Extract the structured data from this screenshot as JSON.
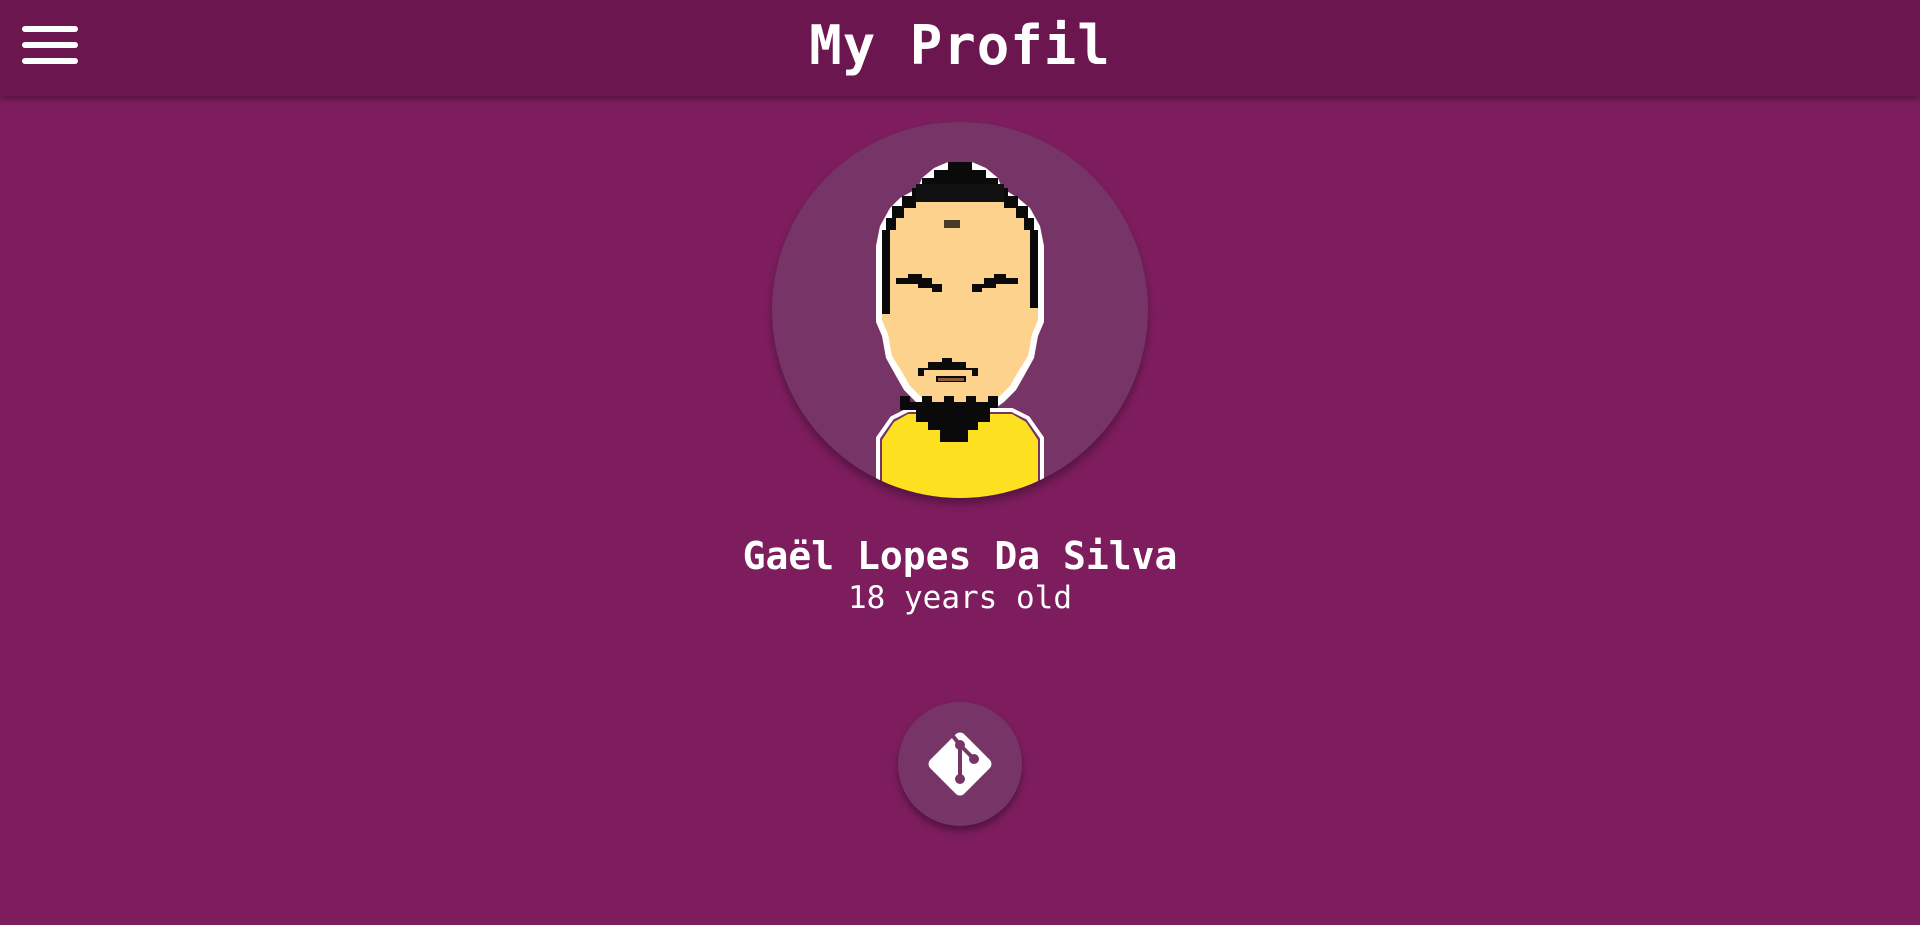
{
  "header": {
    "title": "My Profil",
    "menu_icon": "hamburger-menu-icon"
  },
  "profile": {
    "avatar_icon": "pixel-art-avatar",
    "name": "Gaël Lopes Da Silva",
    "age_text": "18 years old"
  },
  "links": {
    "git_icon": "git-icon"
  },
  "colors": {
    "background": "#7d1d5e",
    "header": "#6c1650",
    "circle": "#763566",
    "text": "#ffffff",
    "skin": "#fdd28c",
    "shirt": "#fde020",
    "hair": "#0a0a0a"
  }
}
